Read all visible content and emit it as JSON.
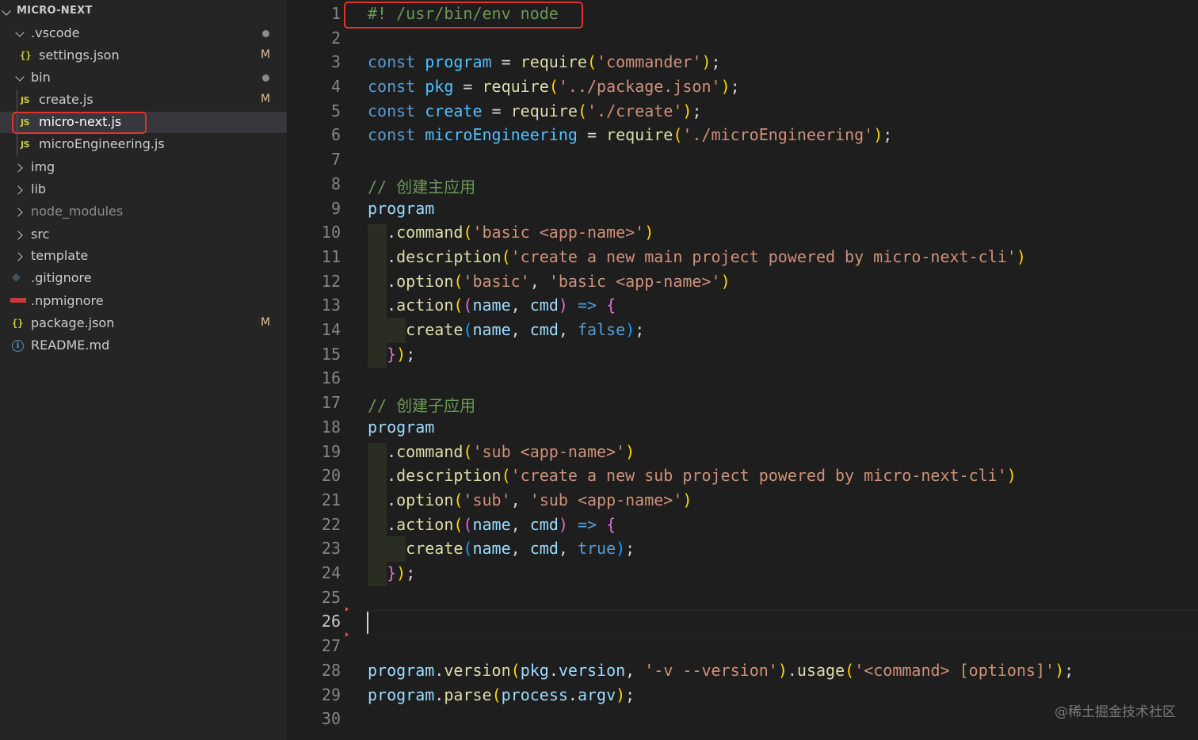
{
  "explorer": {
    "title": "MICRO-NEXT",
    "items": [
      {
        "label": "vscode",
        "prefix": "."
      },
      {
        "label": "settings.json",
        "status": "M"
      },
      {
        "label": "bin"
      },
      {
        "label": "create.js",
        "status": "M"
      },
      {
        "label": "micro-next.js"
      },
      {
        "label": "microEngineering.js"
      },
      {
        "label": "img"
      },
      {
        "label": "lib"
      },
      {
        "label": "node_modules"
      },
      {
        "label": "src"
      },
      {
        "label": "template"
      },
      {
        "label": ".gitignore"
      },
      {
        "label": ".npmignore"
      },
      {
        "label": "package.json",
        "status": "M"
      },
      {
        "label": "README.md"
      }
    ]
  },
  "editor": {
    "line_numbers": [
      "1",
      "2",
      "3",
      "4",
      "5",
      "6",
      "7",
      "8",
      "9",
      "10",
      "11",
      "12",
      "13",
      "14",
      "15",
      "16",
      "17",
      "18",
      "19",
      "20",
      "21",
      "22",
      "23",
      "24",
      "25",
      "26",
      "27",
      "28",
      "29",
      "30"
    ],
    "current_line": "26",
    "shebang": "#! /usr/bin/env node",
    "comment_main": "// 创建主应用",
    "comment_sub": "// 创建子应用",
    "strings": {
      "commander": "'commander'",
      "pkg": "'../package.json'",
      "create": "'./create'",
      "micro": "'./microEngineering'",
      "basic_cmd": "'basic <app-name>'",
      "main_desc": "'create a new main project powered by micro-next-cli'",
      "basic": "'basic'",
      "sub_cmd": "'sub <app-name>'",
      "sub_desc": "'create a new sub project powered by micro-next-cli'",
      "sub": "'sub'",
      "version_flag": "'-v --version'",
      "usage": "'<command> [options]'"
    }
  },
  "watermark": "@稀土掘金技术社区",
  "colors": {
    "highlight": "#e0342a",
    "modified": "#e2c08d"
  }
}
